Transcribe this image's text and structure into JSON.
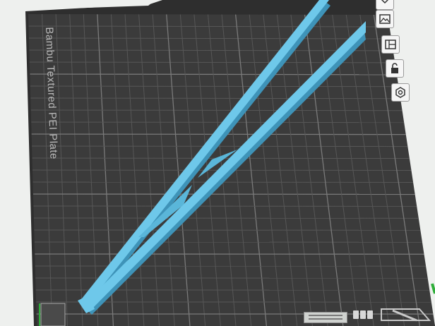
{
  "plate": {
    "label": "Bambu Textured PEI Plate"
  },
  "toolbar": {
    "icons": [
      "image-icon",
      "layout-icon",
      "lock-icon",
      "settings-icon"
    ]
  },
  "colors": {
    "background": "#eef0ee",
    "plate": "#3a3a3a",
    "grid": "#5c5c5c",
    "model": "#6ec8ea",
    "model_shadow": "#3e93b8",
    "axis_green": "#2fae3a"
  }
}
